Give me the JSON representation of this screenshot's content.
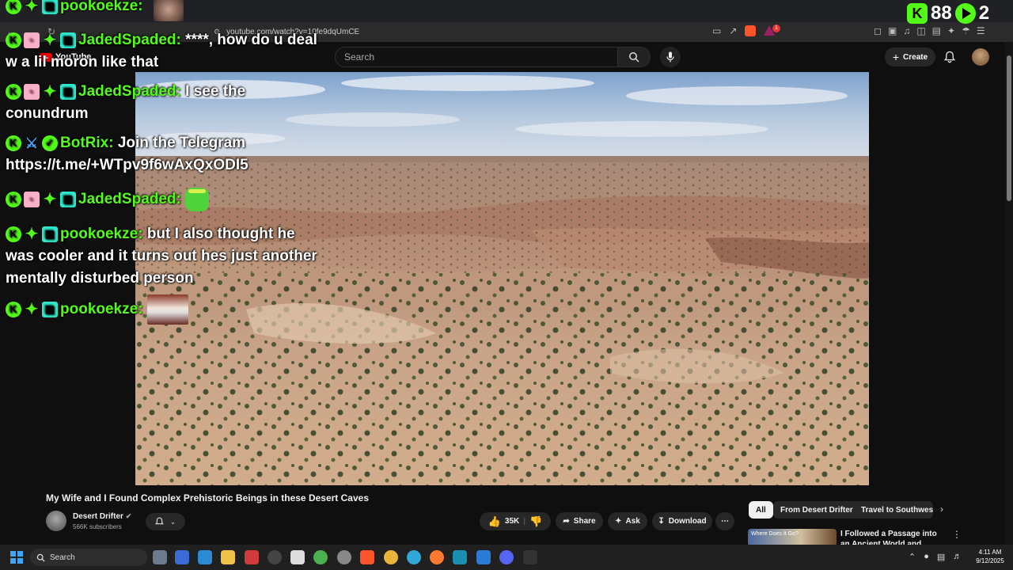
{
  "browser": {
    "url": "youtube.com/watch?v=10fe9dqUmCE",
    "shields_badge": "1"
  },
  "youtube": {
    "logo_text": "YouTube",
    "search_placeholder": "Search",
    "create_label": "Create"
  },
  "kick": {
    "viewers": "88",
    "live_count": "2"
  },
  "chat": [
    {
      "user": "pookoekze:",
      "text": ""
    },
    {
      "user": "JadedSpaded:",
      "text": "****, how do u deal w a lil moron like that"
    },
    {
      "user": "JadedSpaded:",
      "text": "I see the conundrum"
    },
    {
      "user": "BotRix:",
      "text": "Join the Telegram https://t.me/+WTpv9f6wAxQxODI5"
    },
    {
      "user": "JadedSpaded:",
      "text": ""
    },
    {
      "user": "pookoekze:",
      "text": "but I also thought he was cooler and it turns out hes just another mentally disturbed person"
    },
    {
      "user": "pookoekze:",
      "text": ""
    }
  ],
  "video": {
    "title": "My Wife and I Found Complex Prehistoric Beings in these Desert Caves",
    "channel": "Desert Drifter",
    "subscribers": "566K subscribers",
    "likes": "35K",
    "share_label": "Share",
    "ask_label": "Ask",
    "download_label": "Download"
  },
  "chips": [
    "All",
    "From Desert Drifter",
    "Travel to Southwestern"
  ],
  "recommended": {
    "title": "I Followed a Passage into an Ancient World and Found This",
    "thumb_text": "Where Does It Go?"
  },
  "taskbar": {
    "search_label": "Search",
    "time": "4:11 AM",
    "date": "9/12/2025"
  },
  "colors": {
    "kick_green": "#53fc18",
    "youtube_red": "#ff0000",
    "background": "#0f0f0f"
  }
}
